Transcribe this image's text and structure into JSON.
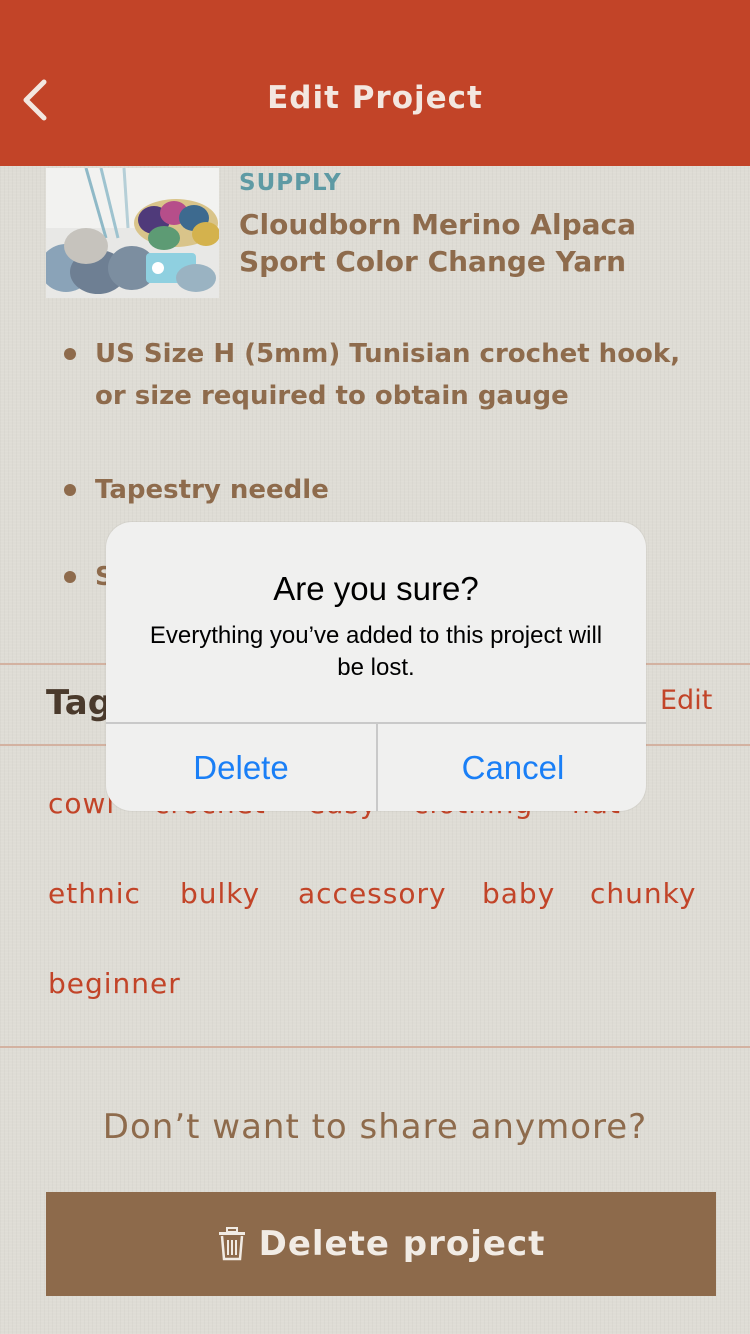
{
  "header": {
    "title": "Edit Project",
    "back_icon": "chevron-left-icon",
    "bg_color": "#c24428"
  },
  "supply": {
    "kind": "SUPPLY",
    "name": "Cloudborn Merino Alpaca Sport Color Change Yarn"
  },
  "bullets": [
    {
      "text": "US Size H (5mm) Tunisian crochet hook, or size required to obtain gauge"
    },
    {
      "text": "Tapestry needle"
    },
    {
      "text": "S"
    }
  ],
  "tags": {
    "heading": "Tag",
    "edit_label": "Edit",
    "items": [
      "cowl",
      "crochet",
      "easy",
      "clothing",
      "hat",
      "ethnic",
      "bulky",
      "accessory",
      "baby",
      "chunky",
      "beginner"
    ]
  },
  "footer": {
    "share_prompt": "Don’t want to share anymore?",
    "delete_label": "Delete project",
    "delete_icon": "trash-icon",
    "button_color": "#8d6a4b"
  },
  "alert": {
    "title": "Are you sure?",
    "message": "Everything you’ve added to this project will be lost.",
    "delete_label": "Delete",
    "cancel_label": "Cancel",
    "button_color": "#1a7ff6"
  }
}
